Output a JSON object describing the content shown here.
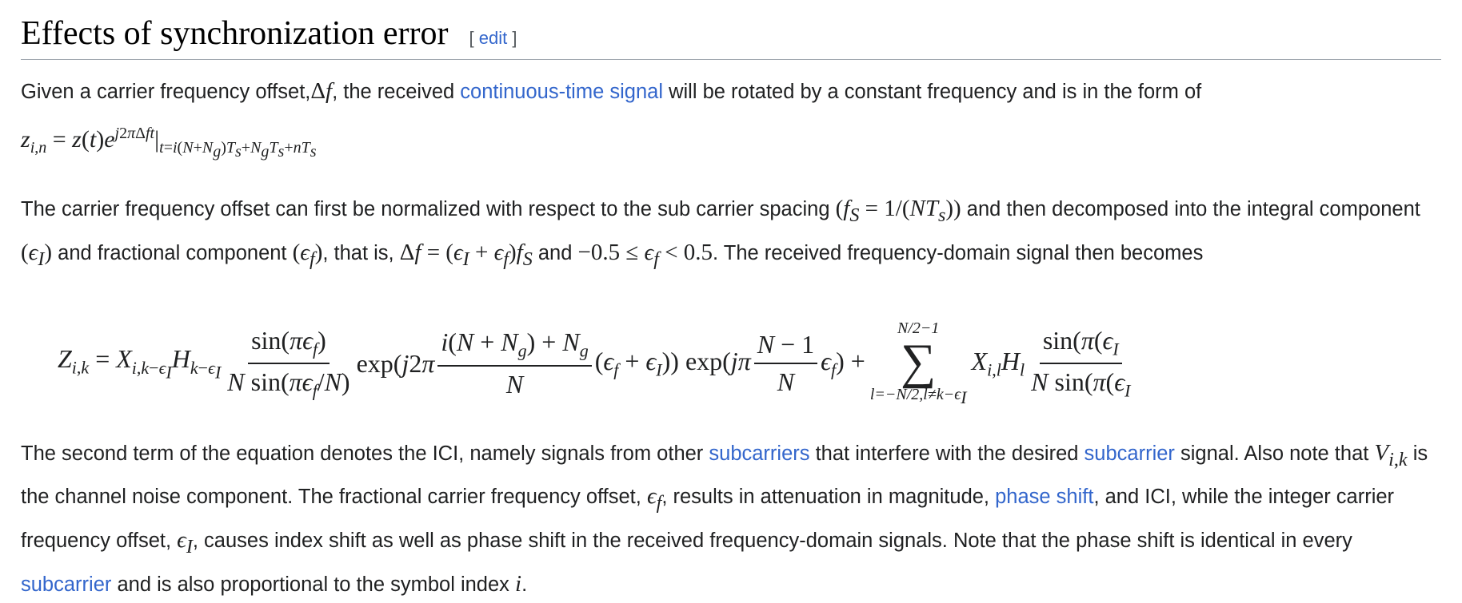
{
  "section": {
    "title": "Effects of synchronization error",
    "edit_open": "[",
    "edit_label": "edit",
    "edit_close": "]"
  },
  "para1": {
    "t1": "Given a carrier frequency offset,",
    "t2": ", the received ",
    "link": "continuous-time signal",
    "t3": " will be rotated by a constant frequency and is in the form of"
  },
  "para2": {
    "t1": "The carrier frequency offset can first be normalized with respect to the sub carrier spacing ",
    "t2": " and then decomposed into the integral component ",
    "t3": " and fractional component ",
    "t4": ", that is, ",
    "t5": " and ",
    "t6": ". The received frequency-domain signal then becomes"
  },
  "para3": {
    "t1": "The second term of the equation denotes the ICI, namely signals from other ",
    "link1": "subcarriers",
    "t2": " that interfere with the desired ",
    "link2": "subcarrier",
    "t3": " signal. Also note that ",
    "t4": " is the channel noise component. The fractional carrier frequency offset, ",
    "t5": ", results in attenuation in magnitude, ",
    "link3": "phase shift",
    "t6": ", and ICI, while the integer carrier frequency offset, ",
    "t7": ", causes index shift as well as phase shift in the received frequency-domain signals. Note that the phase shift is identical in every ",
    "link4": "subcarrier",
    "t8": " and is also proportional to the symbol index ",
    "t9": "."
  }
}
